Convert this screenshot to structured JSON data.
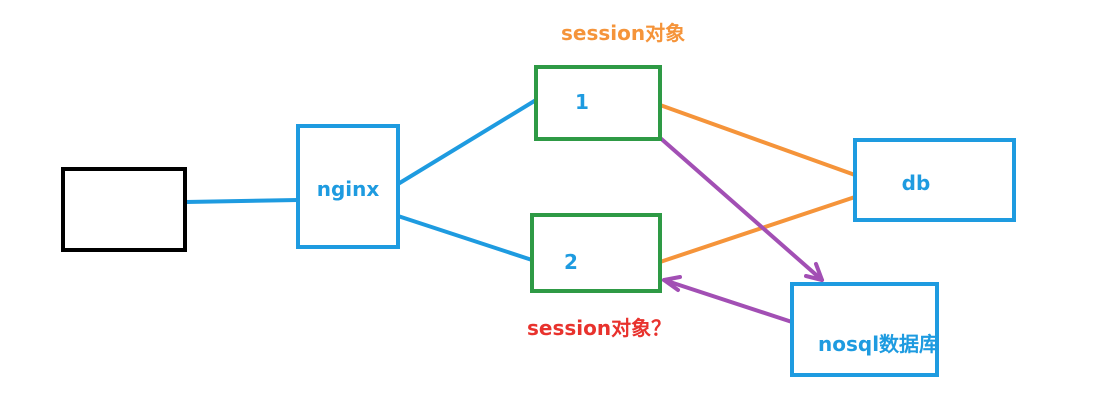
{
  "colors": {
    "client_box": "#000000",
    "nginx_box": "#1e9be0",
    "server_box": "#2e9a45",
    "db_box": "#1e9be0",
    "nosql_box": "#1e9be0",
    "blue_line": "#1e9be0",
    "orange_line": "#f5943a",
    "purple_line": "#a24fb4",
    "label_blue": "#1e9be0",
    "label_orange": "#f5943a",
    "label_red": "#e8322d"
  },
  "nodes": {
    "client": {
      "label": ""
    },
    "nginx": {
      "label": "nginx"
    },
    "server1": {
      "label": "1"
    },
    "server2": {
      "label": "2"
    },
    "db": {
      "label": "db"
    },
    "nosql": {
      "label": "nosql数据库"
    }
  },
  "annotations": {
    "session_top": "session对象",
    "session_bottom": "session对象？"
  }
}
